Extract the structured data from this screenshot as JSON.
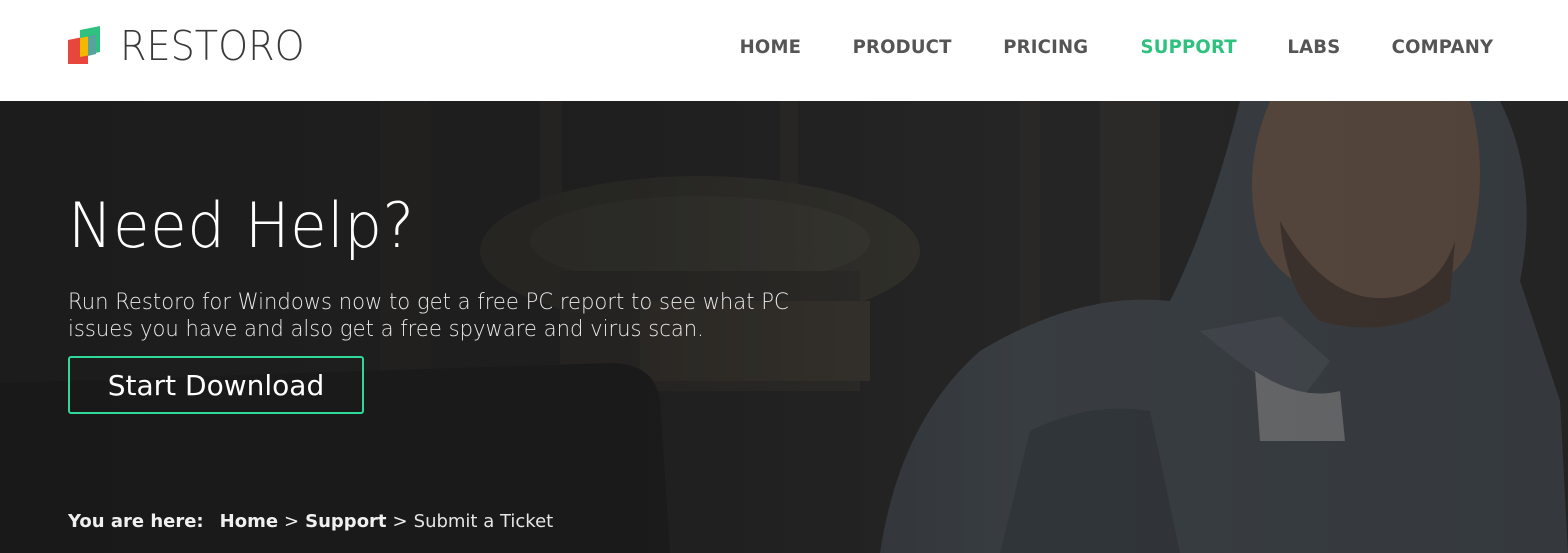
{
  "brand": {
    "name": "RESTORO",
    "logo_colors": {
      "red": "#e8453c",
      "green": "#2ec27e",
      "yellow": "#f5b800",
      "teal": "#3aa0b8"
    }
  },
  "nav": {
    "items": [
      {
        "label": "HOME",
        "active": false
      },
      {
        "label": "PRODUCT",
        "active": false
      },
      {
        "label": "PRICING",
        "active": false
      },
      {
        "label": "SUPPORT",
        "active": true
      },
      {
        "label": "LABS",
        "active": false
      },
      {
        "label": "COMPANY",
        "active": false
      }
    ],
    "active_color": "#2ec27e"
  },
  "hero": {
    "title": "Need Help?",
    "description": "Run Restoro for Windows now to get a free PC report to see what PC issues you have and also get a free spyware and virus scan.",
    "cta_label": "Start Download",
    "cta_border_color": "#2ed99a"
  },
  "breadcrumb": {
    "prefix": "You are here:",
    "items": [
      {
        "label": "Home"
      },
      {
        "label": "Support"
      }
    ],
    "separator": ">",
    "current": "Submit a Ticket"
  }
}
